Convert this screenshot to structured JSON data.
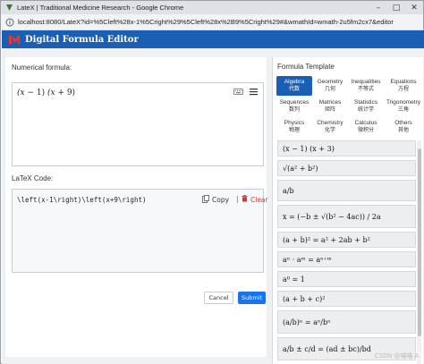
{
  "window": {
    "title": "LateX | Traditional Medicine Research - Google Chrome",
    "url": "localhost:8080/LateX?id=%5Cleft%28x-1%5Cright%29%5Cleft%28x%2B9%5Cright%29#&wmathId=wmath-2u5fm2cx7&editorId=vue-ti..."
  },
  "app": {
    "title": "Digital Formula Editor"
  },
  "editor": {
    "numerical_label": "Numerical formula:",
    "formula_display": "(x − 1) (x + 9)",
    "latex_label": "LaTeX Code:",
    "latex_code": "\\left(x-1\\right)\\left(x+9\\right)",
    "copy_label": "Copy",
    "separator": "|",
    "clear_label": "Clear",
    "cancel_label": "Cancel",
    "submit_label": "Submit"
  },
  "templates": {
    "title": "Formula Template",
    "tabs": [
      {
        "en": "Algebra",
        "zh": "代数",
        "active": true
      },
      {
        "en": "Geometry",
        "zh": "几何",
        "active": false
      },
      {
        "en": "Inequalities",
        "zh": "不等式",
        "active": false
      },
      {
        "en": "Equations",
        "zh": "方程",
        "active": false
      },
      {
        "en": "Sequences",
        "zh": "数列",
        "active": false
      },
      {
        "en": "Matrices",
        "zh": "矩阵",
        "active": false
      },
      {
        "en": "Statistics",
        "zh": "统计学",
        "active": false
      },
      {
        "en": "Trigonometry",
        "zh": "三角",
        "active": false
      },
      {
        "en": "Physics",
        "zh": "物理",
        "active": false
      },
      {
        "en": "Chemistry",
        "zh": "化学",
        "active": false
      },
      {
        "en": "Calculus",
        "zh": "微积分",
        "active": false
      },
      {
        "en": "Others",
        "zh": "其他",
        "active": false
      }
    ],
    "items": [
      "(x − 1) (x + 3)",
      "√(a² + b²)",
      "a/b",
      "x = (−b ± √(b² − 4ac)) / 2a",
      "(a + b)² = a² + 2ab + b²",
      "aⁿ · aᵐ = aⁿ⁺ᵐ",
      "a⁰ = 1",
      "(a + b + c)²",
      "(a/b)ⁿ = aⁿ/bⁿ",
      "a/b ± c/d = (ad ± bc)/bd"
    ]
  },
  "watermark": "CSDN @喵喵 A",
  "colors": {
    "header_bg": "#1a5fb4",
    "submit_bg": "#1a73e8",
    "clear_red": "#d33"
  }
}
